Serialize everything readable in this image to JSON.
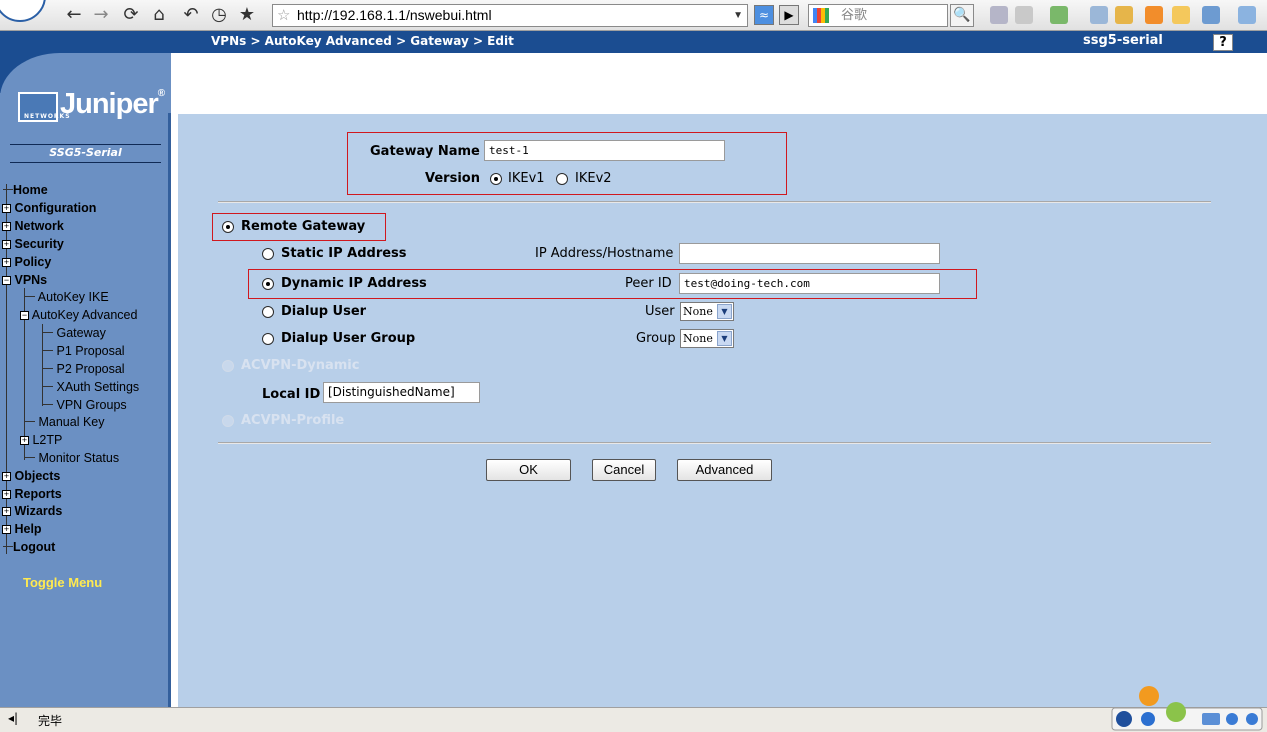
{
  "browser": {
    "url": "http://192.168.1.1/nswebui.html",
    "search_placeholder": "谷歌",
    "status": "完毕"
  },
  "header": {
    "breadcrumb": "VPNs > AutoKey Advanced > Gateway > Edit",
    "device": "ssg5-serial",
    "help_label": "?"
  },
  "sidebar": {
    "brand": "Juniper",
    "brand_sub": "NETWORKS",
    "model": "SSG5-Serial",
    "items": {
      "home": "Home",
      "configuration": "Configuration",
      "network": "Network",
      "security": "Security",
      "policy": "Policy",
      "vpns": "VPNs",
      "autokey_ike": "AutoKey IKE",
      "autokey_advanced": "AutoKey Advanced",
      "gateway": "Gateway",
      "p1_proposal": "P1 Proposal",
      "p2_proposal": "P2 Proposal",
      "xauth_settings": "XAuth Settings",
      "vpn_groups": "VPN Groups",
      "manual_key": "Manual Key",
      "l2tp": "L2TP",
      "monitor_status": "Monitor Status",
      "objects": "Objects",
      "reports": "Reports",
      "wizards": "Wizards",
      "help": "Help",
      "logout": "Logout"
    },
    "toggle_menu": "Toggle Menu"
  },
  "form": {
    "gateway_name_label": "Gateway Name",
    "gateway_name_value": "test-1",
    "version_label": "Version",
    "version_options": [
      "IKEv1",
      "IKEv2"
    ],
    "version_selected": "IKEv1",
    "remote_gateway_label": "Remote Gateway",
    "static_ip_label": "Static IP Address",
    "ip_hostname_label": "IP Address/Hostname",
    "ip_hostname_value": "",
    "dynamic_ip_label": "Dynamic IP Address",
    "peer_id_label": "Peer ID",
    "peer_id_value": "test@doing-tech.com",
    "dialup_user_label": "Dialup User",
    "user_label": "User",
    "user_value": "None",
    "dialup_group_label": "Dialup User Group",
    "group_label": "Group",
    "group_value": "None",
    "acvpn_dynamic_label": "ACVPN-Dynamic",
    "local_id_label": "Local ID",
    "local_id_value": "[DistinguishedName]",
    "acvpn_profile_label": "ACVPN-Profile",
    "ok_label": "OK",
    "cancel_label": "Cancel",
    "advanced_label": "Advanced"
  }
}
